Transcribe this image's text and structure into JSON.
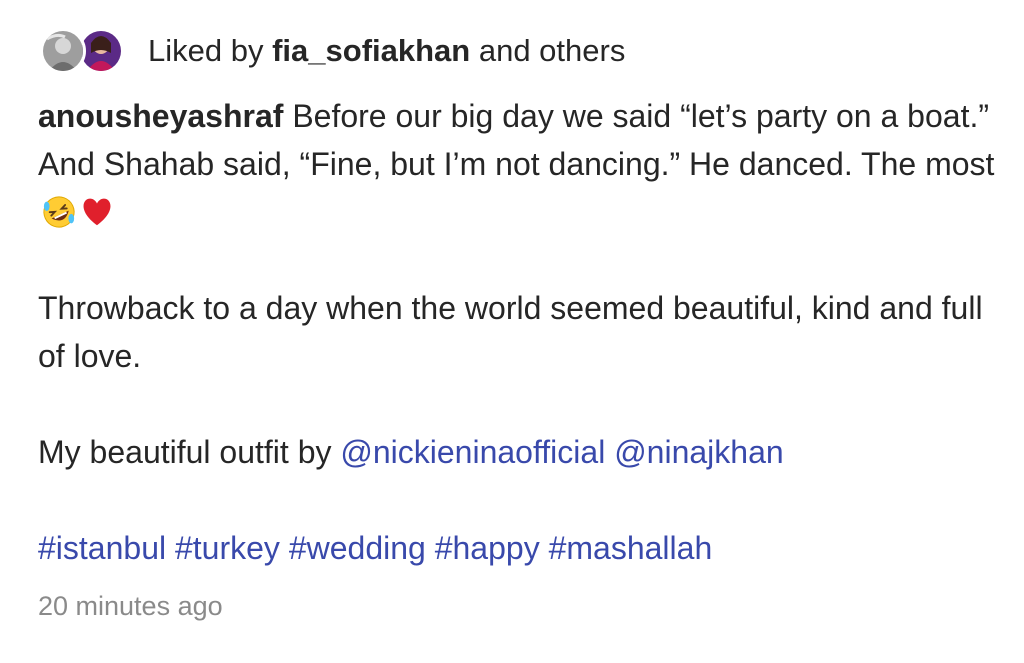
{
  "likes": {
    "prefix": "Liked by",
    "user": "fia_sofiakhan",
    "suffix": "and others"
  },
  "caption": {
    "username": "anousheyashraf",
    "line1": "Before our big day we said “let’s party on a boat.” And Shahab said, “Fine, but I’m not dancing.” He danced. The most",
    "emojis": [
      "rolling-on-floor-laughing-emoji",
      "red-heart-emoji"
    ],
    "paragraph2": "Throwback to a day when the world seemed beautiful, kind and full of love.",
    "outfit_prefix": "My beautiful outfit by",
    "mentions": [
      "@nickieninaofficial",
      "@ninajkhan"
    ],
    "hashtags": [
      "#istanbul",
      "#turkey",
      "#wedding",
      "#happy",
      "#mashallah"
    ]
  },
  "timestamp": "20 minutes ago",
  "colors": {
    "link": "#3949ab",
    "text": "#262626",
    "muted": "#8a8a8a"
  }
}
